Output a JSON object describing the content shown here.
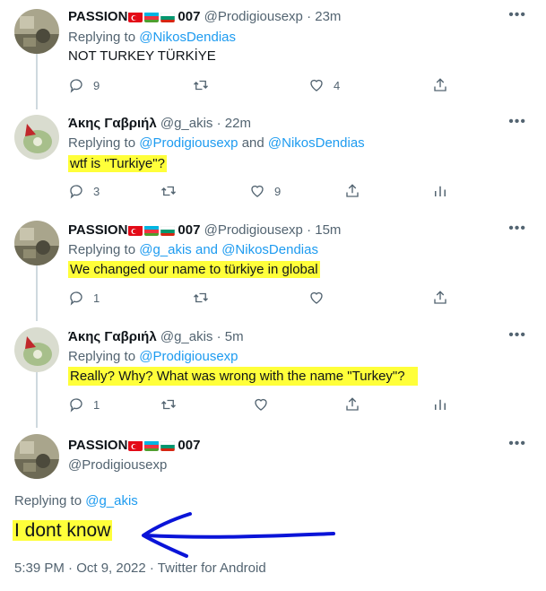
{
  "tweets": [
    {
      "name": "PASSION",
      "suffix": "007",
      "handle": "@Prodigiousexp",
      "time": "· 23m",
      "replying_prefix": "Replying to",
      "replying_to": "@NikosDendias",
      "replying_and": "",
      "replying_to_2": "",
      "text": "NOT TURKEY TÜRKİYE",
      "replies": "9",
      "retweets": "",
      "likes": "4"
    },
    {
      "name": "Άκης Γαβριήλ",
      "suffix": "",
      "handle": "@g_akis",
      "time": "· 22m",
      "replying_prefix": "Replying to",
      "replying_to": "@Prodigiousexp",
      "replying_and": "and",
      "replying_to_2": "@NikosDendias",
      "text": "wtf is \"Turkiye\"?",
      "replies": "3",
      "retweets": "",
      "likes": "9"
    },
    {
      "name": "PASSION",
      "suffix": "007",
      "handle": "@Prodigiousexp",
      "time": "· 15m",
      "replying_prefix": "Replying to",
      "replying_to": "@g_akis",
      "replying_and": "and",
      "replying_to_2": "@NikosDendias",
      "text": "We changed our name to türkiye in global",
      "replies": "1",
      "retweets": "",
      "likes": ""
    },
    {
      "name": "Άκης Γαβριήλ",
      "suffix": "",
      "handle": "@g_akis",
      "time": "· 5m",
      "replying_prefix": "Replying to",
      "replying_to": "@Prodigiousexp",
      "replying_and": "",
      "replying_to_2": "",
      "text": "Really? Why? What was wrong with the name \"Turkey\"?",
      "replies": "1",
      "retweets": "",
      "likes": ""
    }
  ],
  "main": {
    "name": "PASSION",
    "suffix": "007",
    "handle": "@Prodigiousexp",
    "replying_prefix": "Replying to",
    "replying_to": "@g_akis",
    "text": "I dont know",
    "footer": "5:39 PM · Oct 9, 2022 · Twitter for Android"
  },
  "colors": {
    "link": "#1d9bf0",
    "highlight": "#ffff3a",
    "muted": "#536471",
    "arrow": "#0a14d8"
  },
  "icons": [
    "reply-icon",
    "retweet-icon",
    "like-icon",
    "share-icon",
    "analytics-icon",
    "more-icon"
  ]
}
